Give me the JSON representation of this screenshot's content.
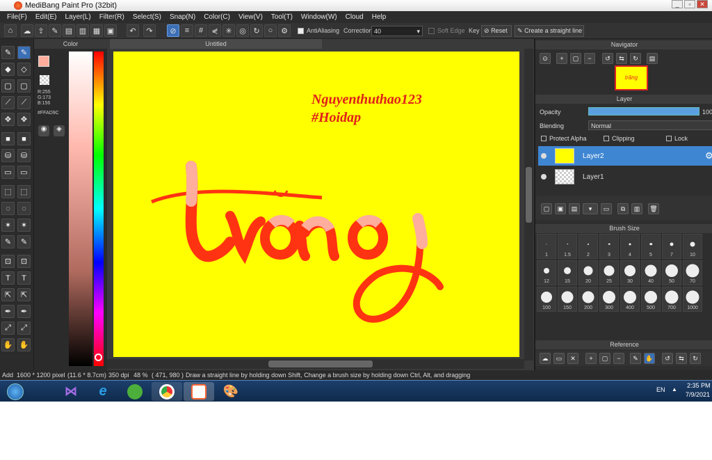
{
  "window": {
    "title": "MediBang Paint Pro (32bit)"
  },
  "menu": [
    "File(F)",
    "Edit(E)",
    "Layer(L)",
    "Filter(R)",
    "Select(S)",
    "Snap(N)",
    "Color(C)",
    "View(V)",
    "Tool(T)",
    "Window(W)",
    "Cloud",
    "Help"
  ],
  "toolbar": {
    "antialiasing": "AntiAliasing",
    "correction_label": "Correction",
    "correction_value": "40",
    "soft_edge": "Soft Edge",
    "key": "Key",
    "reset": "Reset",
    "straight_line": "Create a straight line"
  },
  "color_panel": {
    "title": "Color",
    "r": "R:255",
    "g": "G:173",
    "b": "B:156",
    "hex": "#FFAD9C",
    "primary": "#FFAD9C",
    "bg_swatch": "#ff5533"
  },
  "document": {
    "tab": "Untitled",
    "canvas_color": "#ffff00",
    "signature_line1": "Nguyenthuthao123",
    "signature_line2": "#Hoidap",
    "lettering": "trăng",
    "lettering_color": "#ff3311",
    "highlight_color": "#ffad9c"
  },
  "navigator": {
    "title": "Navigator"
  },
  "layer_panel": {
    "title": "Layer",
    "opacity_label": "Opacity",
    "opacity_value": "100",
    "blending_label": "Blending",
    "blending_value": "Normal",
    "protect_alpha": "Protect Alpha",
    "clipping": "Clipping",
    "lock": "Lock",
    "layers": [
      {
        "name": "Layer2",
        "selected": true
      },
      {
        "name": "Layer1",
        "selected": false
      }
    ]
  },
  "brush_size": {
    "title": "Brush Size",
    "sizes": [
      "1",
      "1.5",
      "2",
      "3",
      "4",
      "5",
      "7",
      "10",
      "12",
      "15",
      "20",
      "25",
      "30",
      "40",
      "50",
      "70",
      "100",
      "150",
      "200",
      "300",
      "400",
      "500",
      "700",
      "1000"
    ]
  },
  "reference": {
    "title": "Reference"
  },
  "status": {
    "add": "Add",
    "dimensions": "1600 * 1200 pixel",
    "physical": "(11.6 * 8.7cm)",
    "dpi": "350 dpi",
    "zoom": "48 %",
    "coords": "( 471, 980 )",
    "hint": "Draw a straight line by holding down Shift, Change a brush size by holding down Ctrl, Alt, and dragging"
  },
  "taskbar": {
    "lang": "EN",
    "time": "2:35 PM",
    "date": "7/9/2021"
  }
}
